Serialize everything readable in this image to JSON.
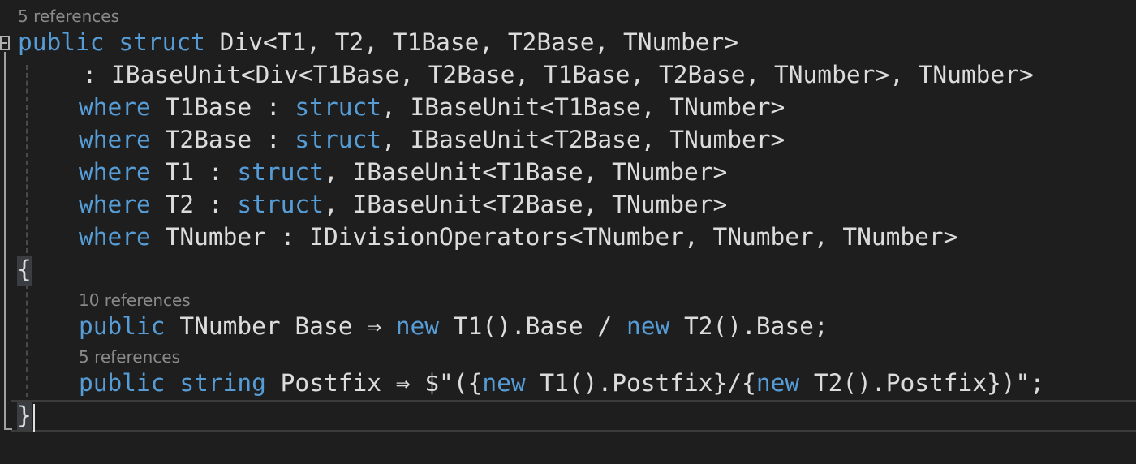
{
  "codelens": {
    "struct_refs": "5 references",
    "base_refs": "10 references",
    "postfix_refs": "5 references"
  },
  "code": {
    "l1": {
      "public": "public",
      "struct": "struct",
      "sig": " Div<T1, T2, T1Base, T2Base, TNumber>"
    },
    "l2": {
      "text": "  : IBaseUnit<Div<T1Base, T2Base, T1Base, T2Base, TNumber>, TNumber>"
    },
    "l3": {
      "where": "where",
      "a": " T1Base : ",
      "struct": "struct",
      "b": ", IBaseUnit<T1Base, TNumber>"
    },
    "l4": {
      "where": "where",
      "a": " T2Base : ",
      "struct": "struct",
      "b": ", IBaseUnit<T2Base, TNumber>"
    },
    "l5": {
      "where": "where",
      "a": " T1 : ",
      "struct": "struct",
      "b": ", IBaseUnit<T1Base, TNumber>"
    },
    "l6": {
      "where": "where",
      "a": " T2 : ",
      "struct": "struct",
      "b": ", IBaseUnit<T2Base, TNumber>"
    },
    "l7": {
      "where": "where",
      "a": " TNumber : IDivisionOperators<TNumber, TNumber, TNumber>"
    },
    "l8": {
      "brace": "{"
    },
    "l9": {
      "public": "public",
      "a": " TNumber Base ⇒ ",
      "new1": "new",
      "b": " T1().Base / ",
      "new2": "new",
      "c": " T2().Base;"
    },
    "l10": {
      "public": "public",
      "string": " string",
      "a": " Postfix ⇒ ",
      "s1": "$\"(",
      "i1": "{",
      "new1": "new",
      "b": " T1().Postfix",
      "i2": "}",
      "s2": "/",
      "i3": "{",
      "new2": "new",
      "c": " T2().Postfix",
      "i4": "}",
      "s3": ")\"",
      "d": ";"
    },
    "l11": {
      "brace": "}"
    }
  },
  "colors": {
    "background": "#1e1e1e",
    "keyword": "#569cd6",
    "text": "#dcdcdc",
    "codelens": "#8a8a8a",
    "string": "#d69d85"
  }
}
